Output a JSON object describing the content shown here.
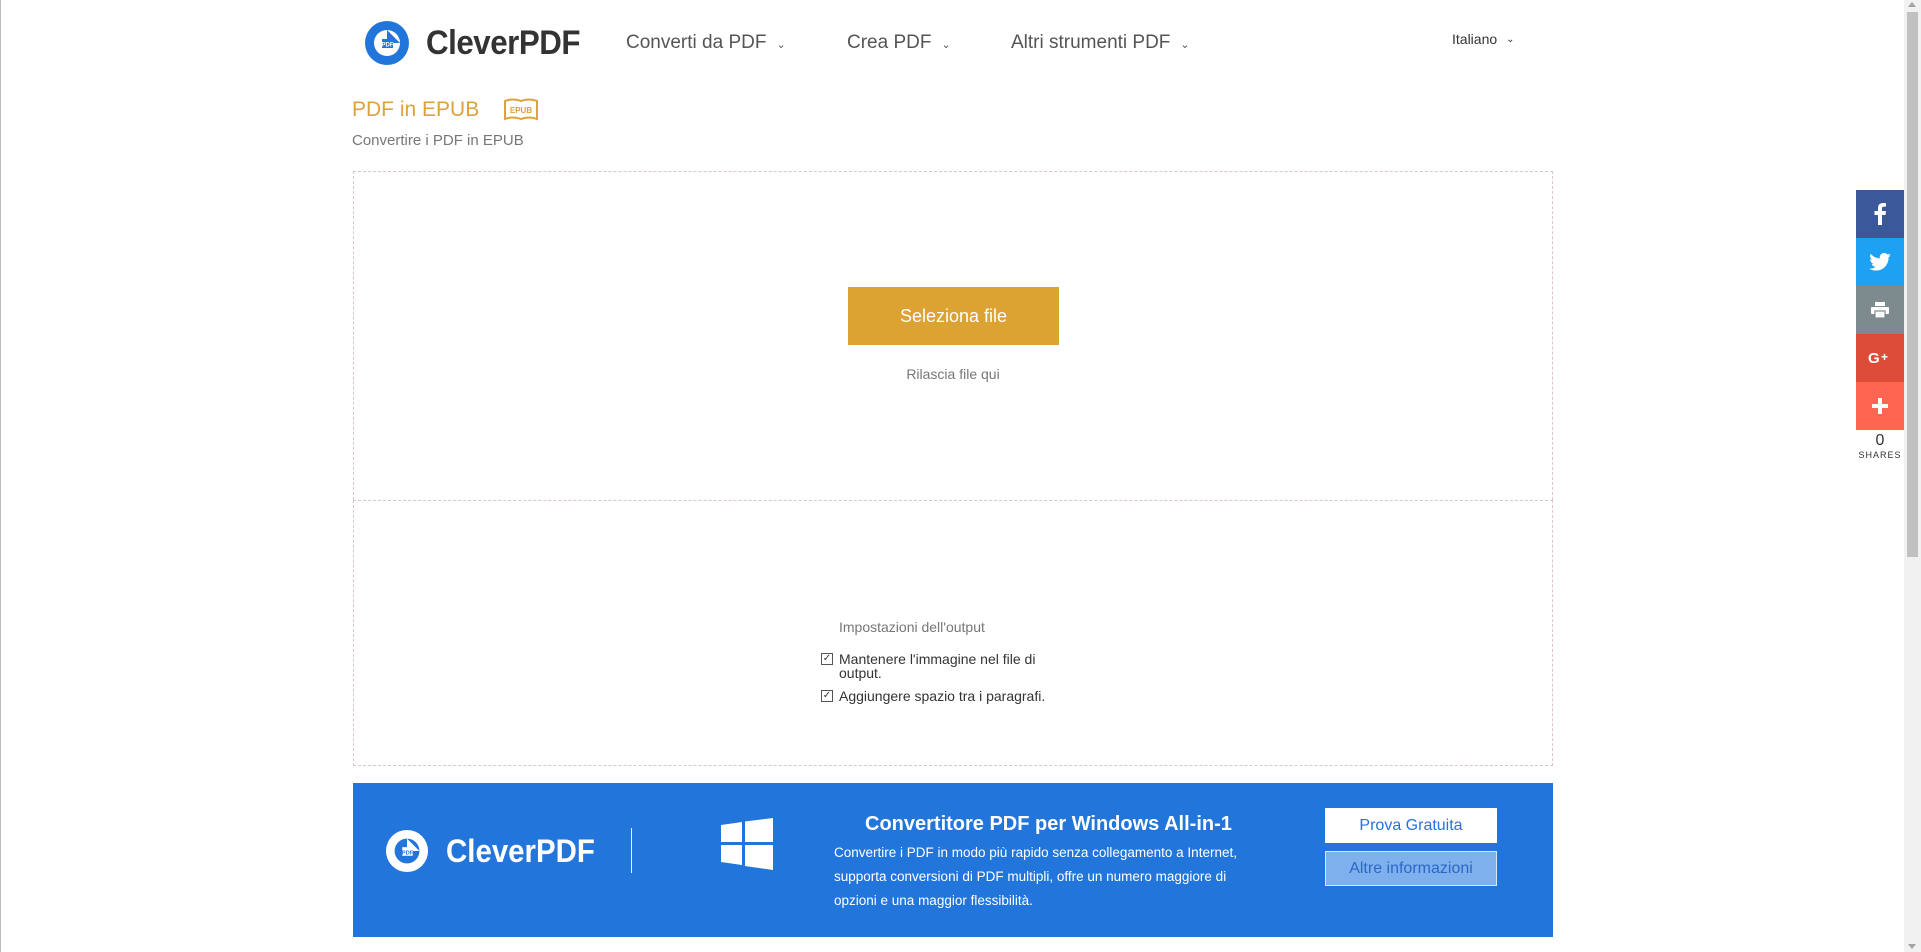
{
  "brand": {
    "name": "CleverPDF",
    "logo_badge": "PDF"
  },
  "nav": {
    "items": [
      {
        "label": "Converti da PDF"
      },
      {
        "label": "Crea PDF"
      },
      {
        "label": "Altri strumenti PDF"
      }
    ],
    "language": "Italiano"
  },
  "page": {
    "title": "PDF in EPUB",
    "icon_label": "EPUB",
    "subtitle": "Convertire i PDF in EPUB"
  },
  "upload": {
    "select_button": "Seleziona file",
    "drop_hint": "Rilascia file qui"
  },
  "options": {
    "title": "Impostazioni dell'output",
    "items": [
      {
        "label": "Mantenere l'immagine nel file di output.",
        "checked": true
      },
      {
        "label": "Aggiungere spazio tra i paragrafi.",
        "checked": true
      }
    ]
  },
  "banner": {
    "title": "Convertitore PDF per Windows All-in-1",
    "description": "Convertire i PDF in modo più rapido senza collegamento a Internet, supporta conversioni di PDF multipli, offre un numero maggiore di opzioni e una maggior flessibilità.",
    "try_button": "Prova Gratuita",
    "more_button": "Altre informazioni",
    "color": "#2275db"
  },
  "share": {
    "count": "0",
    "label": "SHARES",
    "buttons": [
      "facebook-icon",
      "twitter-icon",
      "print-icon",
      "google-plus-icon",
      "plus-icon"
    ]
  },
  "colors": {
    "accent": "#dda332",
    "title": "#dda23b"
  }
}
